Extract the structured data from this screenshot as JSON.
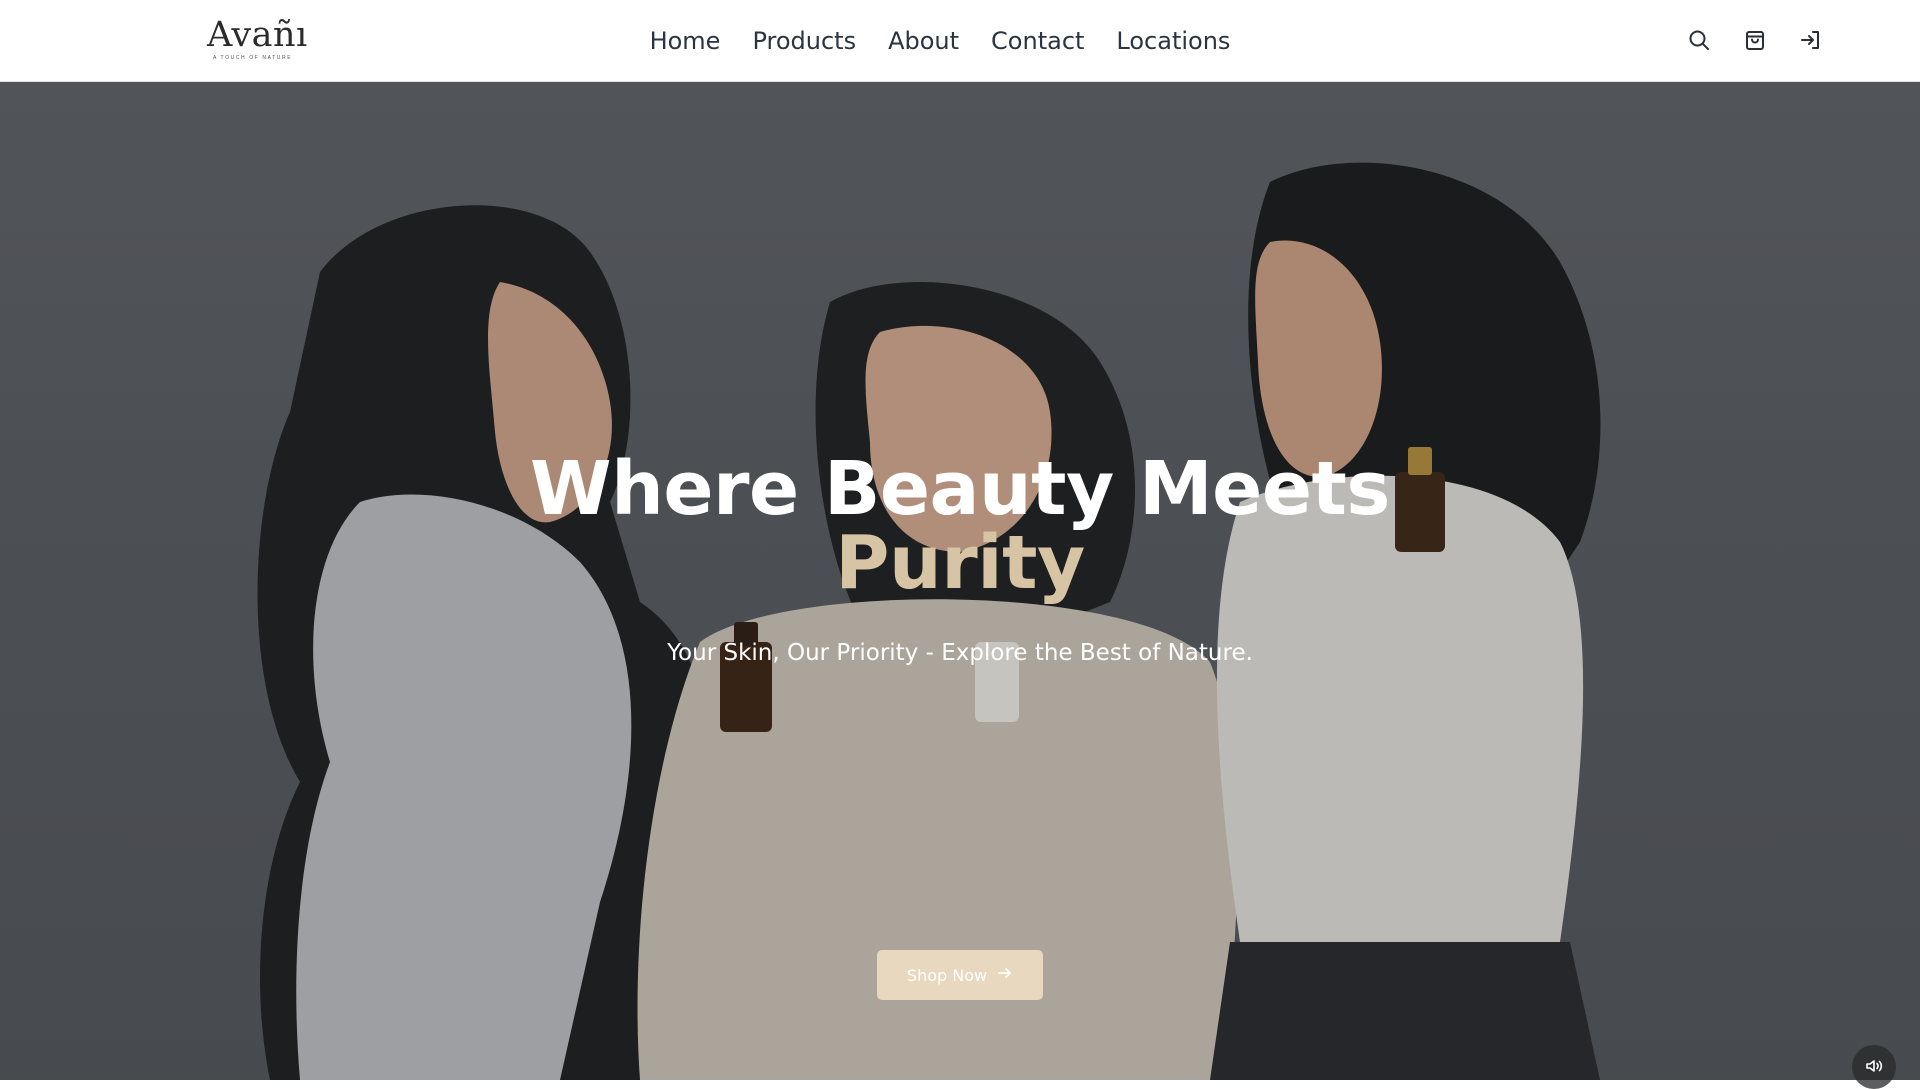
{
  "brand": {
    "name": "Avañı",
    "tagline": "A touch of nature"
  },
  "nav": {
    "items": [
      {
        "label": "Home"
      },
      {
        "label": "Products"
      },
      {
        "label": "About"
      },
      {
        "label": "Contact"
      },
      {
        "label": "Locations"
      }
    ]
  },
  "header_actions": {
    "icons": [
      "search-icon",
      "shopping-bag-icon",
      "sign-in-icon"
    ]
  },
  "hero": {
    "title_line1": "Where Beauty Meets",
    "title_accent": "Purity",
    "subtitle": "Your Skin, Our Priority - Explore the Best of Nature.",
    "cta_label": "Shop Now",
    "cta_icon": "arrow-right-icon",
    "sound_icon": "volume-icon"
  },
  "colors": {
    "accent": "#d7c4a4",
    "cta_background": "#e7d8bf",
    "nav_text": "#2a3442",
    "hero_overlay": "#55585d"
  }
}
